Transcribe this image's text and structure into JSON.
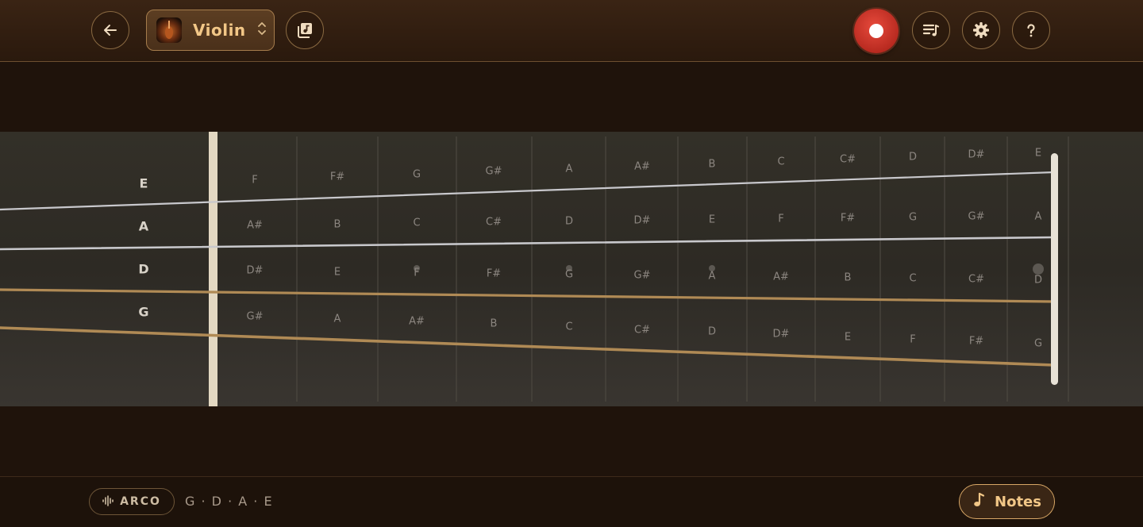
{
  "header": {
    "instrument_label": "Violin",
    "icons": {
      "back": "arrow-left-icon",
      "selector": "chevron-up-down-icon",
      "library": "music-library-icon",
      "record": "record-icon",
      "playlist": "playlist-icon",
      "settings": "gear-icon",
      "help": "question-icon"
    }
  },
  "fingerboard": {
    "string_names": [
      "E",
      "A",
      "D",
      "G"
    ],
    "rows": [
      [
        "F",
        "F#",
        "G",
        "G#",
        "A",
        "A#",
        "B",
        "C",
        "C#",
        "D",
        "D#",
        "E"
      ],
      [
        "A#",
        "B",
        "C",
        "C#",
        "D",
        "D#",
        "E",
        "F",
        "F#",
        "G",
        "G#",
        "A"
      ],
      [
        "D#",
        "E",
        "F",
        "F#",
        "G",
        "G#",
        "A",
        "A#",
        "B",
        "C",
        "C#",
        "D"
      ],
      [
        "G#",
        "A",
        "A#",
        "B",
        "C",
        "C#",
        "D",
        "D#",
        "E",
        "F",
        "F#",
        "G"
      ]
    ],
    "colors": {
      "treble_string": "#c8c8cc",
      "bass_string": "#b08a55",
      "note_text": "#8c8680"
    }
  },
  "footer": {
    "mode_label": "ARCO",
    "tuning_label": "G · D · A · E",
    "notes_label": "Notes",
    "icons": {
      "mode": "waveform-icon",
      "notes": "music-note-icon"
    }
  },
  "colors": {
    "accent": "#f2c787",
    "record": "#d63a2e",
    "background": "#1f130b"
  }
}
